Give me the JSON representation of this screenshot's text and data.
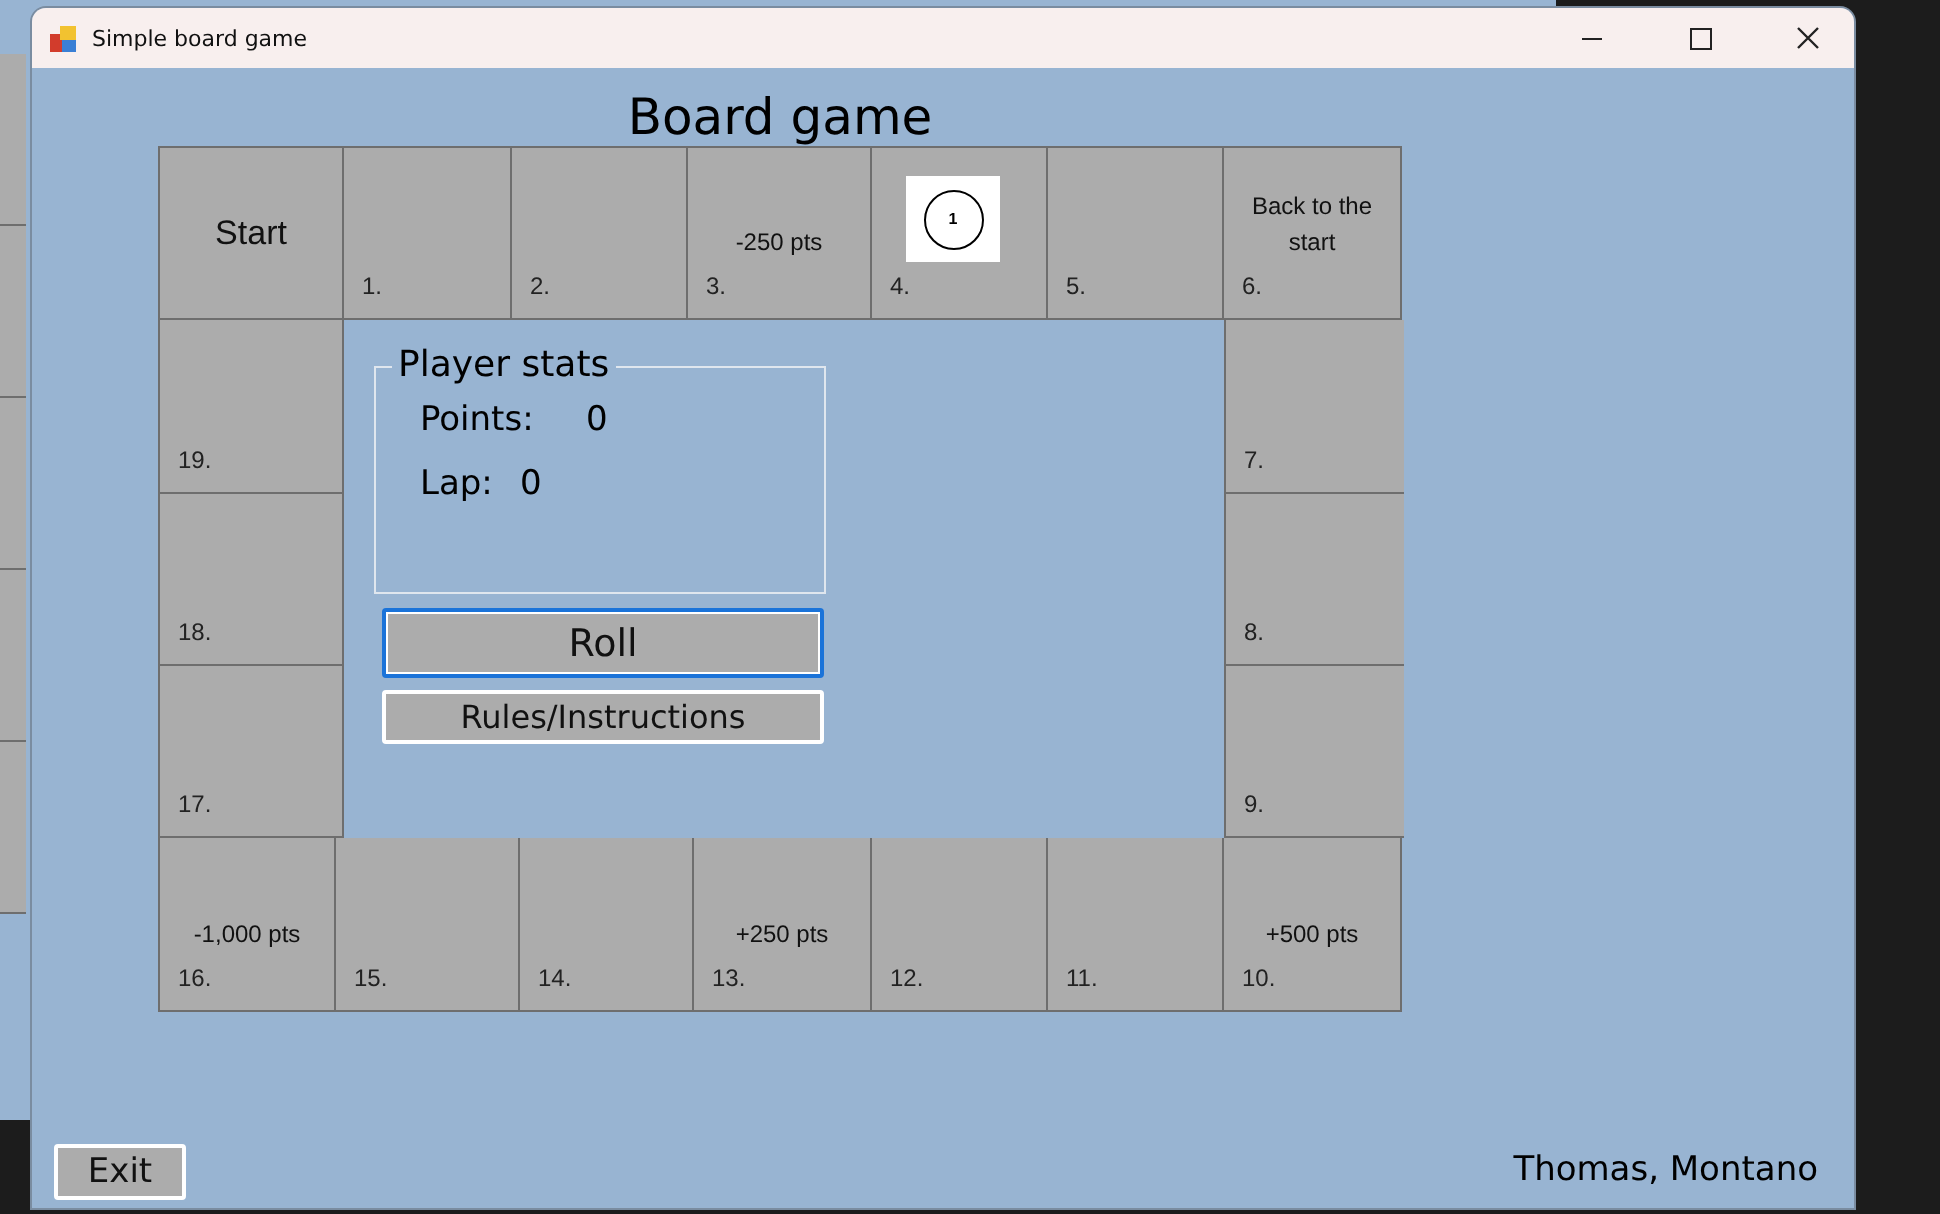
{
  "window": {
    "title": "Simple board game"
  },
  "heading": "Board game",
  "board": {
    "top": [
      {
        "kind": "start",
        "label": "Start"
      },
      {
        "kind": "square",
        "number": "1."
      },
      {
        "kind": "square",
        "number": "2."
      },
      {
        "kind": "square",
        "label": "-250 pts",
        "number": "3."
      },
      {
        "kind": "token",
        "token": "1",
        "number": "4."
      },
      {
        "kind": "square",
        "number": "5."
      },
      {
        "kind": "square",
        "label": "Back to the start",
        "number": "6."
      }
    ],
    "right": [
      {
        "kind": "square",
        "number": "7."
      },
      {
        "kind": "square",
        "number": "8."
      },
      {
        "kind": "square",
        "number": "9."
      }
    ],
    "bottom": [
      {
        "kind": "square",
        "label": "-1,000 pts",
        "number": "16."
      },
      {
        "kind": "square",
        "number": "15."
      },
      {
        "kind": "square",
        "number": "14."
      },
      {
        "kind": "square",
        "label": "+250 pts",
        "number": "13."
      },
      {
        "kind": "square",
        "number": "12."
      },
      {
        "kind": "square",
        "number": "11."
      },
      {
        "kind": "square",
        "label": "+500 pts",
        "number": "10."
      }
    ],
    "left": [
      {
        "kind": "square",
        "number": "19."
      },
      {
        "kind": "square",
        "number": "18."
      },
      {
        "kind": "square",
        "number": "17."
      }
    ]
  },
  "player_stats": {
    "title": "Player stats",
    "points_label": "Points:",
    "points": "0",
    "lap_label": "Lap:",
    "lap": "0"
  },
  "buttons": [
    {
      "label": "Roll",
      "focused": true
    },
    {
      "label": "Rules/Instructions",
      "focused": false
    }
  ],
  "exit_button": "Exit",
  "author": "Thomas, Montano"
}
